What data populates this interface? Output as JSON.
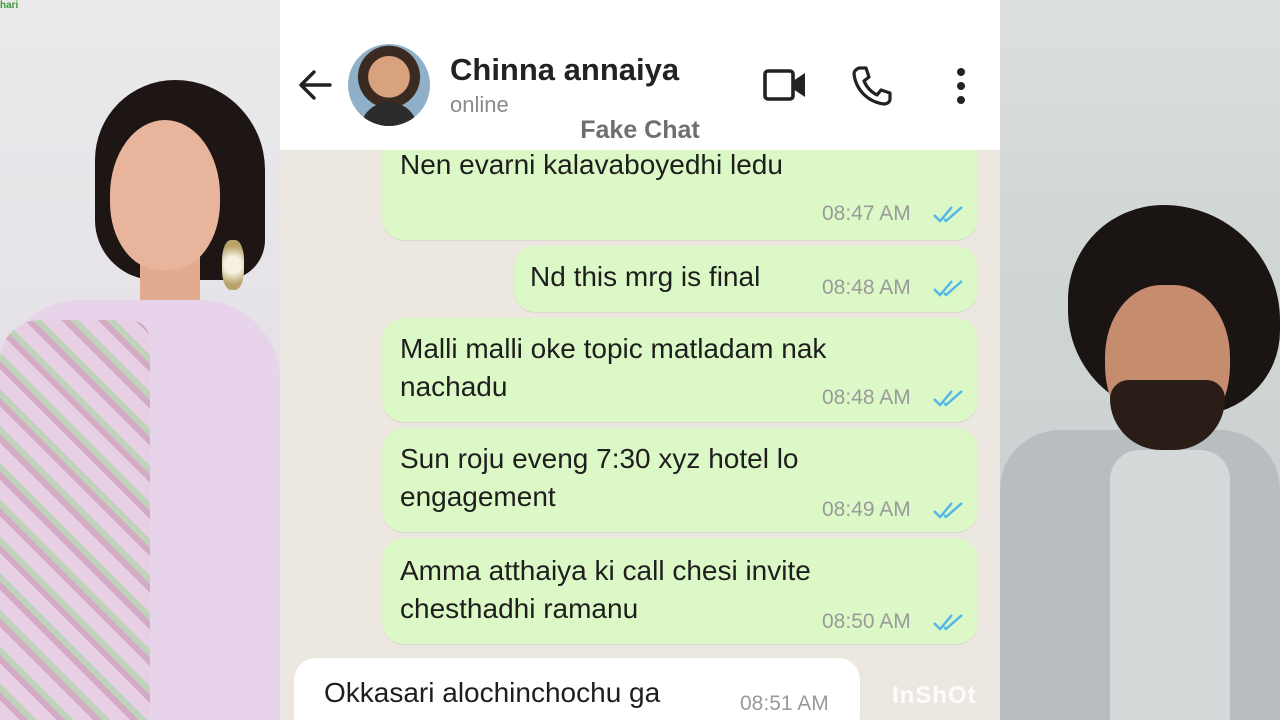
{
  "left_panel": {
    "logo_text": "hari"
  },
  "header": {
    "contact_name": "Chinna annaiya",
    "status": "online",
    "icons": [
      "back-arrow-icon",
      "video-call-icon",
      "phone-icon",
      "more-vertical-icon"
    ]
  },
  "watermark_top": "Fake Chat",
  "watermark_bottom": "InShOt",
  "colors": {
    "outgoing_bubble": "#dcf8c6",
    "incoming_bubble": "#ffffff",
    "read_ticks": "#4fb6ec",
    "chat_bg": "#ece8e1"
  },
  "messages": [
    {
      "direction": "out",
      "text_line1": "Nen evarni kalavaboyedhi ledu",
      "text_line2": "",
      "time": "08:47 AM",
      "read": true
    },
    {
      "direction": "out",
      "text_line1": "Nd this mrg is final",
      "text_line2": "",
      "time": "08:48 AM",
      "read": true
    },
    {
      "direction": "out",
      "text_line1": "Malli malli oke topic matladam nak",
      "text_line2": "nachadu",
      "time": "08:48 AM",
      "read": true
    },
    {
      "direction": "out",
      "text_line1": "Sun roju eveng 7:30 xyz hotel lo",
      "text_line2": "engagement",
      "time": "08:49 AM",
      "read": true
    },
    {
      "direction": "out",
      "text_line1": "Amma atthaiya ki call chesi invite",
      "text_line2": "chesthadhi ramanu",
      "time": "08:50 AM",
      "read": true
    },
    {
      "direction": "in",
      "text_line1": "Okkasari alochinchochu ga",
      "text_line2": "",
      "time": "08:51 AM",
      "read": false
    }
  ]
}
